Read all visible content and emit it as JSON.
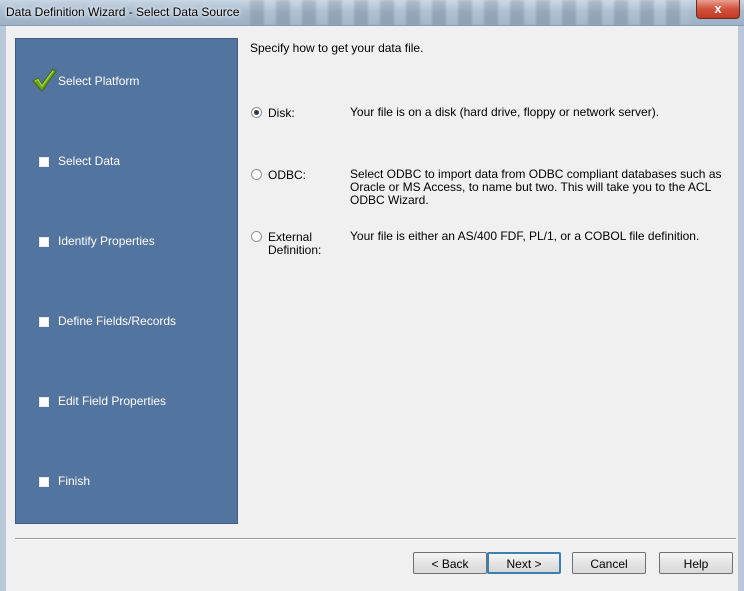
{
  "window": {
    "title": "Data Definition Wizard - Select Data Source",
    "close_glyph": "x"
  },
  "steps": [
    {
      "label": "Select Platform",
      "state": "completed"
    },
    {
      "label": "Select Data",
      "state": "pending"
    },
    {
      "label": "Identify Properties",
      "state": "pending"
    },
    {
      "label": "Define Fields/Records",
      "state": "pending"
    },
    {
      "label": "Edit Field Properties",
      "state": "pending"
    },
    {
      "label": "Finish",
      "state": "pending"
    }
  ],
  "main": {
    "instruction": "Specify how to get your data file.",
    "options": [
      {
        "label": "Disk:",
        "description": "Your file is on a disk (hard drive, floppy or network server).",
        "selected": true
      },
      {
        "label": "ODBC:",
        "description": "Select ODBC to import data from ODBC compliant databases such as Oracle or MS Access, to name but two. This will take you to the ACL ODBC Wizard.",
        "selected": false
      },
      {
        "label_line1": "External",
        "label_line2": "Definition:",
        "description": "Your file is either an AS/400 FDF, PL/1, or a COBOL file definition.",
        "selected": false
      }
    ]
  },
  "buttons": {
    "back": "< Back",
    "next": "Next >",
    "cancel": "Cancel",
    "help": "Help"
  },
  "colors": {
    "step_panel": "#52749e",
    "checkmark": "#6aa514",
    "default_button_border": "#3c7fb1"
  }
}
